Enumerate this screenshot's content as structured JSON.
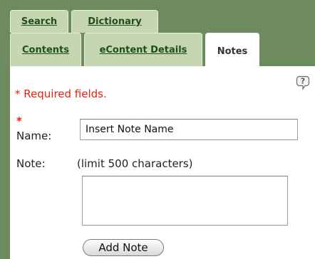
{
  "tabs": {
    "row1": [
      {
        "label": "Search"
      },
      {
        "label": "Dictionary"
      }
    ],
    "row2": [
      {
        "label": "Contents"
      },
      {
        "label": "eContent Details"
      },
      {
        "label": "Notes",
        "active": true
      }
    ]
  },
  "form": {
    "required_notice": "* Required fields.",
    "required_star": "*",
    "name_label": "Name:",
    "name_value": "Insert Note Name",
    "note_label": "Note:",
    "note_limit": "(limit 500 characters)",
    "note_value": "",
    "submit_label": "Add Note"
  },
  "icons": {
    "help": "help-question-icon"
  },
  "colors": {
    "sidebar_green": "#6e8a5f",
    "tab_inactive": "#c6d6b0",
    "tab_text": "#1e4e1c",
    "required_red": "#e8200c"
  }
}
